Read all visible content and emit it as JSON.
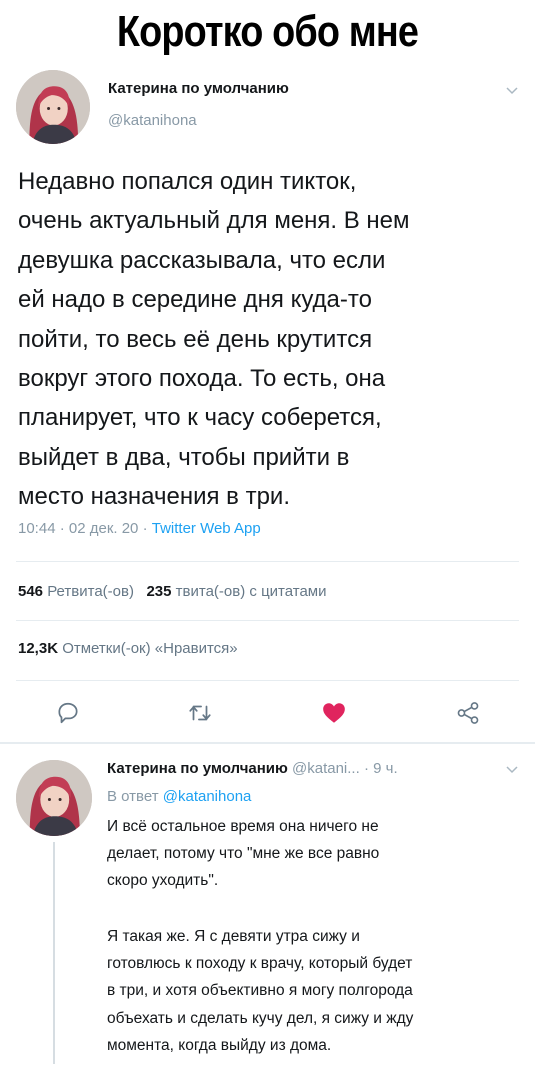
{
  "meme_title": "Коротко обо мне",
  "tweet": {
    "author_name": "Катерина по умолчанию",
    "handle": "@katanihona",
    "text_lines": [
      "Недавно попался один тикток,",
      "очень актуальный для меня. В нем",
      "девушка рассказывала, что если",
      "ей надо в середине дня куда-то",
      "пойти, то весь её день крутится",
      "вокруг этого похода. То есть, она",
      "планирует, что к часу соберется,",
      "выйдет в два, чтобы прийти в",
      "место назначения в три."
    ],
    "time": "10:44 · 02 дек. 20 · ",
    "app": "Twitter Web App",
    "retweets_count": "546",
    "retweets_label": "Ретвита(-ов)",
    "quotes_count": "235",
    "quotes_label": "твита(-ов) с цитатами",
    "likes_count": "12,3K",
    "likes_label": "Отметки(-ок) «Нравится»",
    "actions": [
      {
        "icon": "reply-icon"
      },
      {
        "icon": "retweet-icon"
      },
      {
        "icon": "heart-icon",
        "color": "#e0245e"
      },
      {
        "icon": "share-icon"
      }
    ]
  },
  "reply": {
    "author_name": "Катерина по умолчанию",
    "handle_truncated": "@katani...",
    "age": "· 9 ч.",
    "reply_to_label": "В ответ ",
    "reply_to_handle": "@katanihona",
    "paragraph1_lines": [
      "И всё остальное время она ничего не",
      "делает, потому что \"мне же все равно",
      "скоро уходить\"."
    ],
    "paragraph2_lines": [
      "Я такая же. Я с девяти утра сижу и",
      "готовлюсь к походу к врачу, который будет",
      "в три, и хотя объективно я могу полгорода",
      "объехать и сделать кучу дел, я сижу и жду",
      "момента, когда выйду из дома."
    ]
  },
  "colors": {
    "link": "#1da1f2",
    "muted": "#8899a6",
    "like": "#e0245e"
  }
}
